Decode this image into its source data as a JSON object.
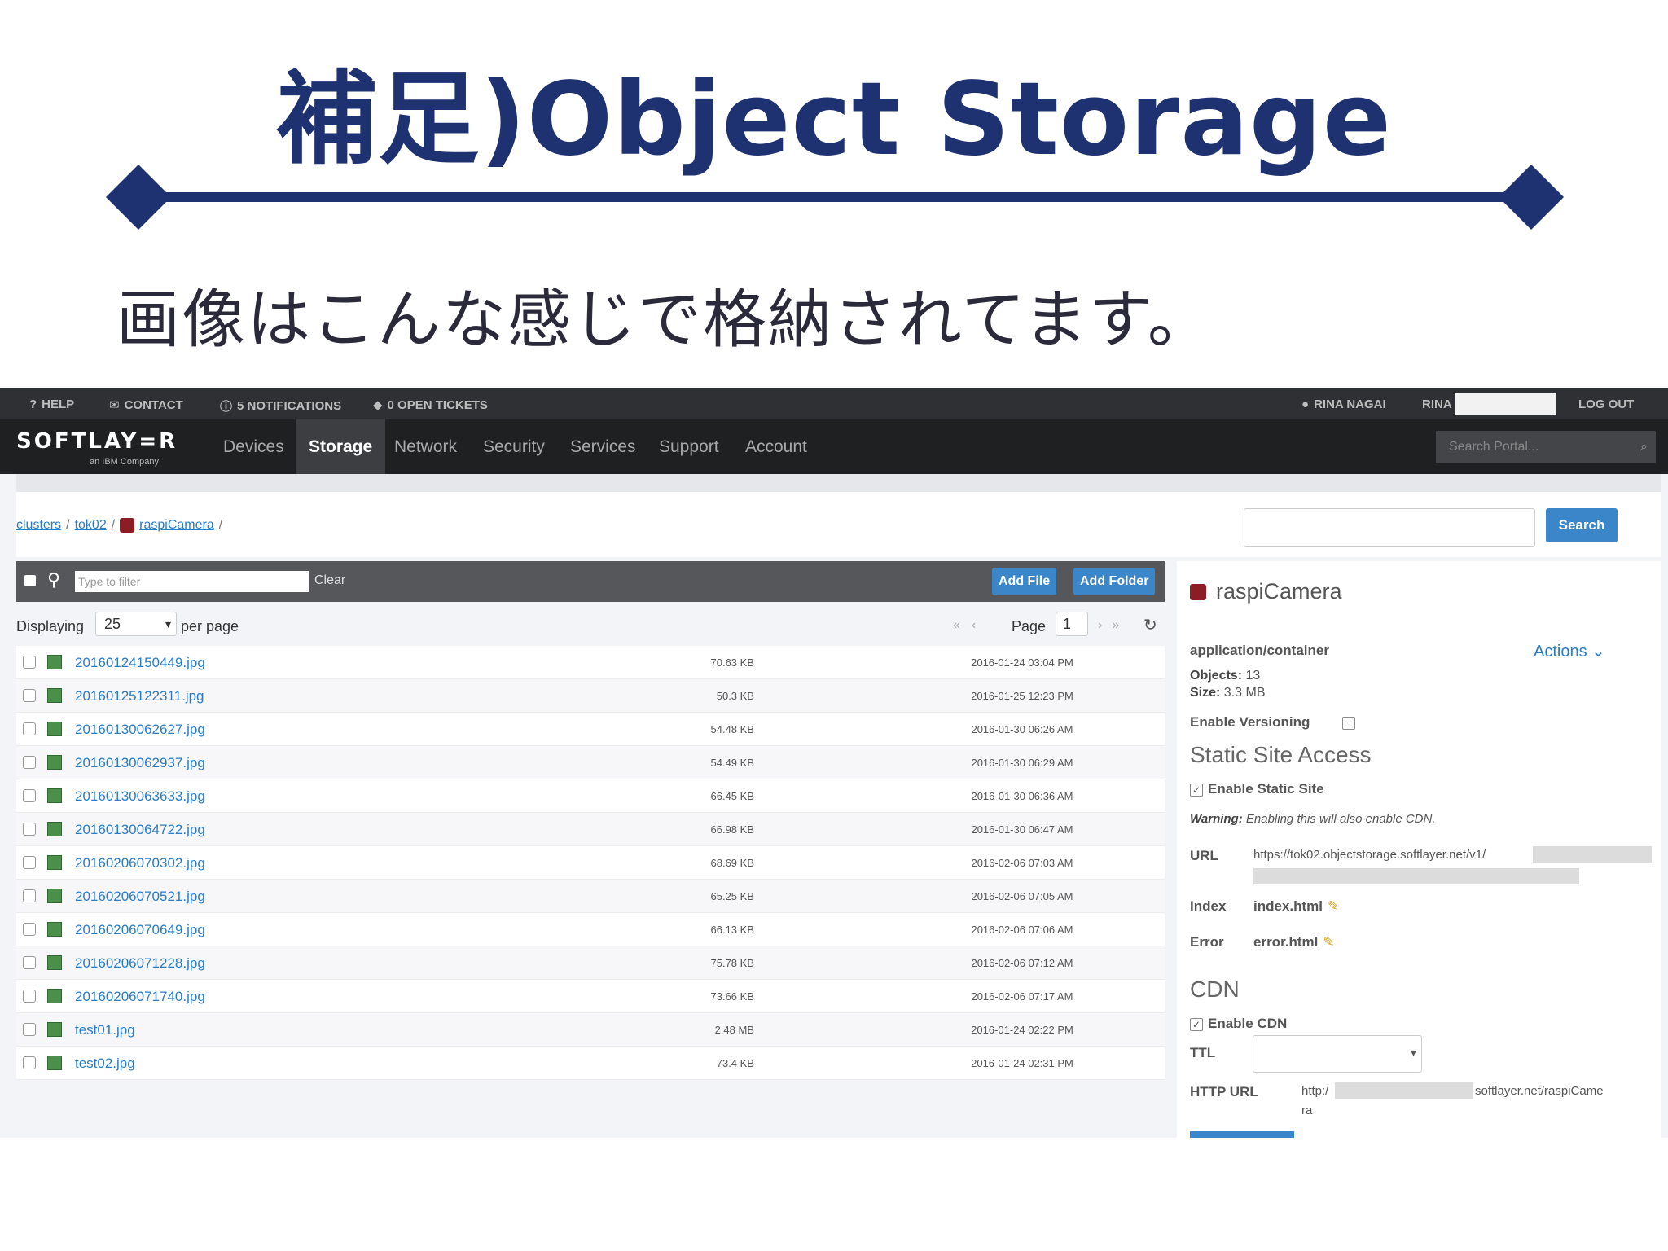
{
  "slide": {
    "title": "補足)Object Storage",
    "subtitle": "画像はこんな感じで格納されてます。"
  },
  "topbar": {
    "help": "HELP",
    "contact": "CONTACT",
    "notifications": "5 NOTIFICATIONS",
    "tickets": "0 OPEN TICKETS",
    "user": "RINA NAGAI",
    "account_short": "RINA",
    "logout": "LOG OUT"
  },
  "navbar": {
    "logo": "SOFTLAY=R",
    "logo_sub": "an IBM Company",
    "items": [
      "Devices",
      "Storage",
      "Network",
      "Security",
      "Services",
      "Support",
      "Account"
    ],
    "active": "Storage",
    "search_placeholder": "Search Portal..."
  },
  "breadcrumb": {
    "items": [
      "clusters",
      "tok02",
      "raspiCamera"
    ],
    "separator": "/"
  },
  "search": {
    "button": "Search"
  },
  "toolbar": {
    "filter_placeholder": "Type to filter",
    "clear": "Clear",
    "add_file": "Add File",
    "add_folder": "Add Folder"
  },
  "pager": {
    "displaying": "Displaying",
    "per_page_value": "25",
    "per_page": "per page",
    "page_label": "Page",
    "page_value": "1"
  },
  "files": [
    {
      "name": "20160124150449.jpg",
      "size": "70.63 KB",
      "date": "2016-01-24 03:04 PM"
    },
    {
      "name": "20160125122311.jpg",
      "size": "50.3 KB",
      "date": "2016-01-25 12:23 PM"
    },
    {
      "name": "20160130062627.jpg",
      "size": "54.48 KB",
      "date": "2016-01-30 06:26 AM"
    },
    {
      "name": "20160130062937.jpg",
      "size": "54.49 KB",
      "date": "2016-01-30 06:29 AM"
    },
    {
      "name": "20160130063633.jpg",
      "size": "66.45 KB",
      "date": "2016-01-30 06:36 AM"
    },
    {
      "name": "20160130064722.jpg",
      "size": "66.98 KB",
      "date": "2016-01-30 06:47 AM"
    },
    {
      "name": "20160206070302.jpg",
      "size": "68.69 KB",
      "date": "2016-02-06 07:03 AM"
    },
    {
      "name": "20160206070521.jpg",
      "size": "65.25 KB",
      "date": "2016-02-06 07:05 AM"
    },
    {
      "name": "20160206070649.jpg",
      "size": "66.13 KB",
      "date": "2016-02-06 07:06 AM"
    },
    {
      "name": "20160206071228.jpg",
      "size": "75.78 KB",
      "date": "2016-02-06 07:12 AM"
    },
    {
      "name": "20160206071740.jpg",
      "size": "73.66 KB",
      "date": "2016-02-06 07:17 AM"
    },
    {
      "name": "test01.jpg",
      "size": "2.48 MB",
      "date": "2016-01-24 02:22 PM"
    },
    {
      "name": "test02.jpg",
      "size": "73.4 KB",
      "date": "2016-01-24 02:31 PM"
    }
  ],
  "container": {
    "name": "raspiCamera",
    "type": "application/container",
    "actions": "Actions",
    "objects_label": "Objects:",
    "objects": "13",
    "size_label": "Size:",
    "size": "3.3 MB",
    "versioning_label": "Enable Versioning",
    "static_heading": "Static Site Access",
    "static_enable": "Enable Static Site",
    "warning_label": "Warning:",
    "warning_text": "Enabling this will also enable CDN.",
    "url_label": "URL",
    "url_value": "https://tok02.objectstorage.softlayer.net/v1/",
    "index_label": "Index",
    "index_value": "index.html",
    "error_label": "Error",
    "error_value": "error.html",
    "cdn_heading": "CDN",
    "cdn_enable": "Enable CDN",
    "ttl_label": "TTL",
    "http_url_label": "HTTP URL",
    "http_url_prefix": "http:/",
    "http_url_suffix": "softlayer.net/raspiCame",
    "http_url_tail": "ra"
  },
  "colors": {
    "title_navy": "#1e3170",
    "nav_dark": "#1f2022",
    "link_blue": "#2a7cc7",
    "button_blue": "#3a86c8",
    "cube_red": "#8b1d24"
  }
}
